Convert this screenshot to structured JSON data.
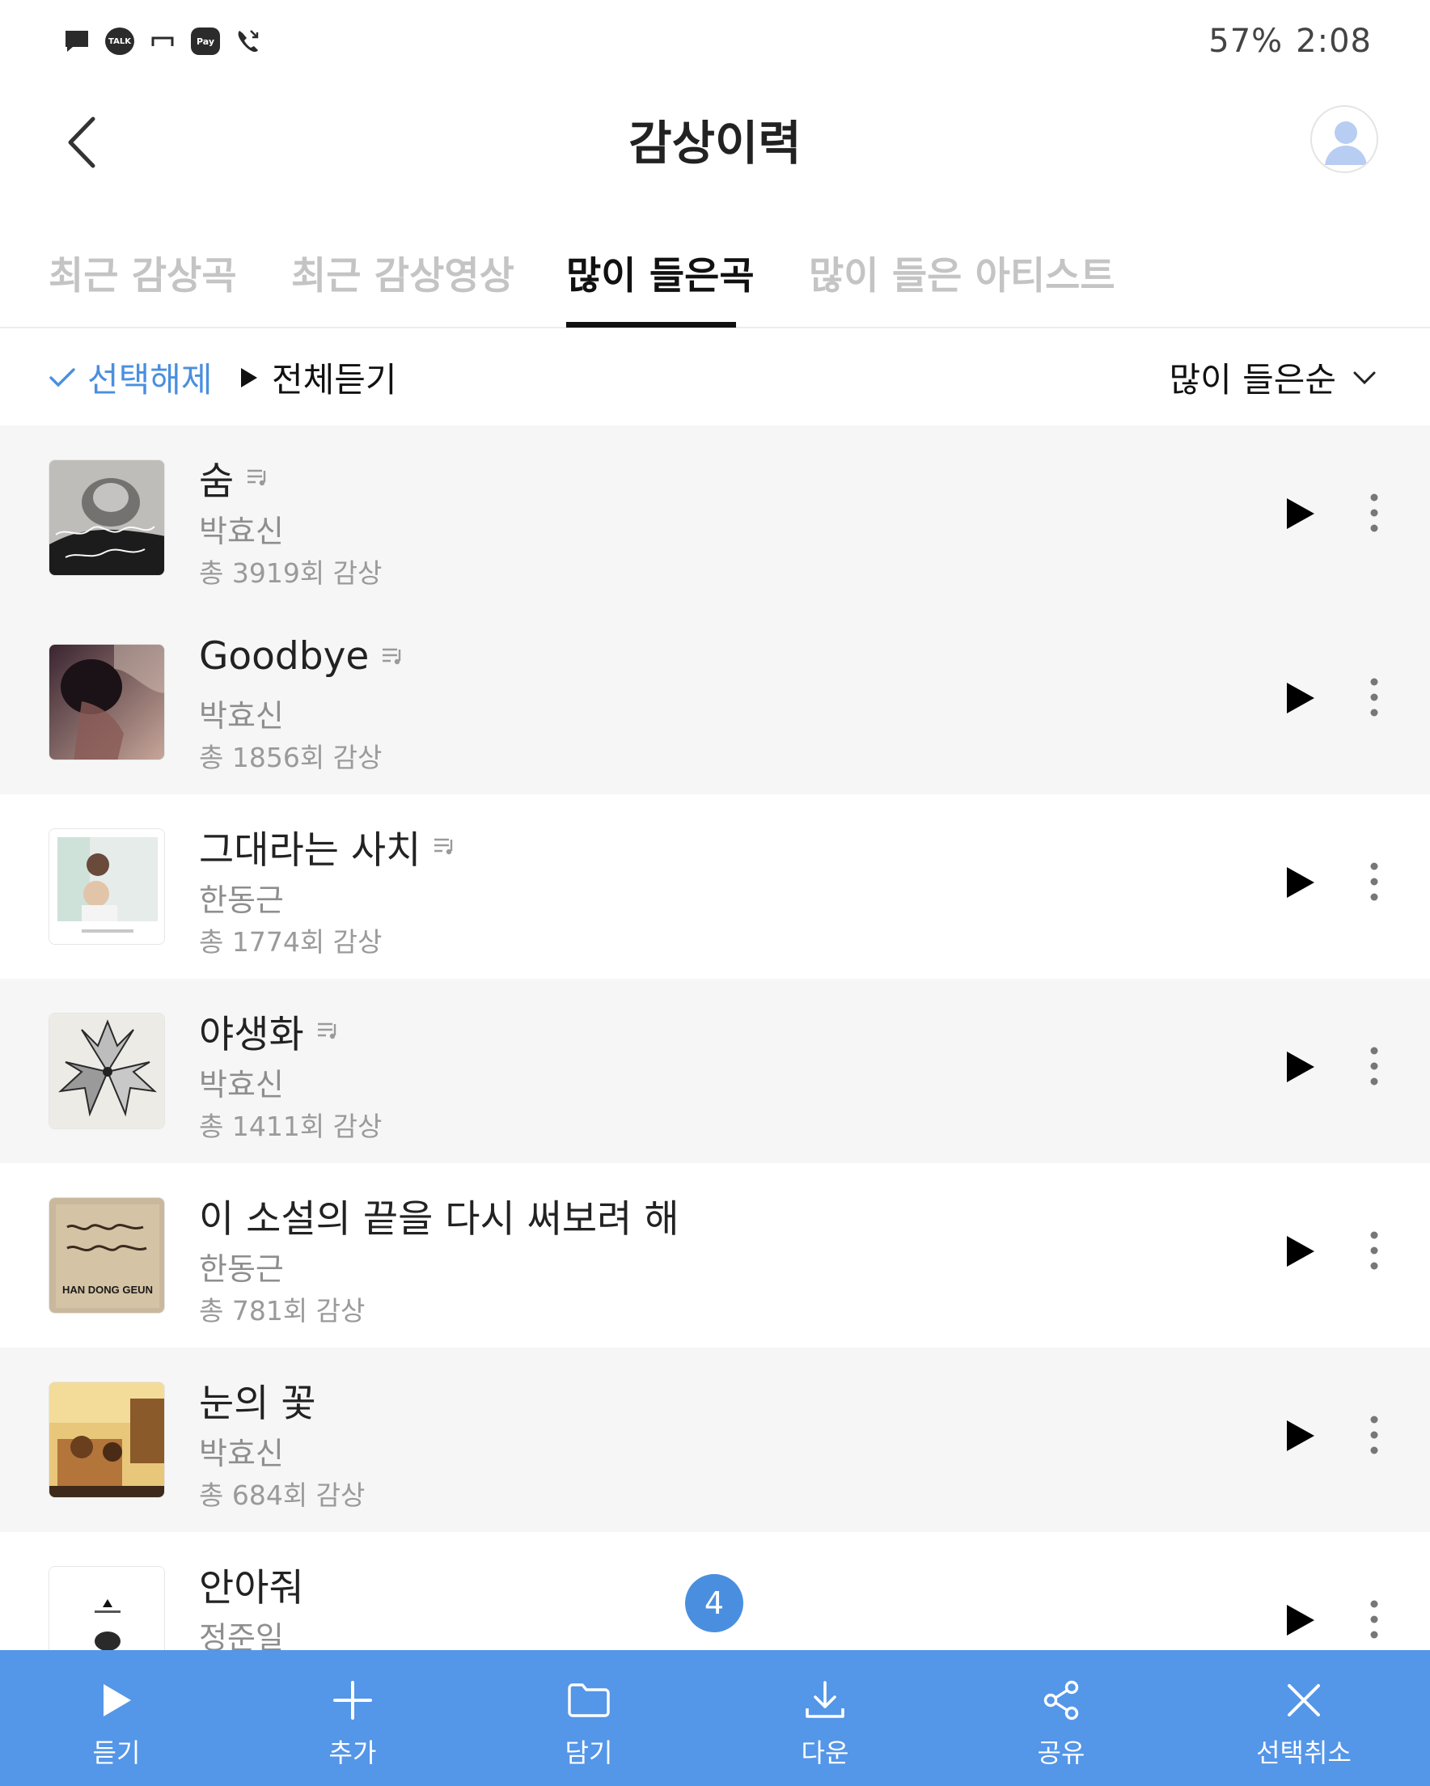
{
  "status_bar": {
    "talk_label": "TALK",
    "pay_label": "Pay",
    "battery": "57%",
    "time": "2:08"
  },
  "header": {
    "title": "감상이력"
  },
  "tabs": [
    {
      "label": "최근 감상곡",
      "active": false
    },
    {
      "label": "최근 감상영상",
      "active": false
    },
    {
      "label": "많이 들은곡",
      "active": true
    },
    {
      "label": "많이 들은 아티스트",
      "active": false
    }
  ],
  "toolbar": {
    "deselect_label": "선택해제",
    "play_all_label": "전체듣기",
    "sort_label": "많이 들은순"
  },
  "songs": [
    {
      "title": "숨",
      "artist": "박효신",
      "count": "총 3919회 감상",
      "selected": true,
      "has_lyrics": true
    },
    {
      "title": "Goodbye",
      "artist": "박효신",
      "count": "총 1856회 감상",
      "selected": true,
      "has_lyrics": true
    },
    {
      "title": "그대라는 사치",
      "artist": "한동근",
      "count": "총 1774회 감상",
      "selected": false,
      "has_lyrics": true
    },
    {
      "title": "야생화",
      "artist": "박효신",
      "count": "총 1411회 감상",
      "selected": true,
      "has_lyrics": true
    },
    {
      "title": "이 소설의 끝을 다시 써보려 해",
      "artist": "한동근",
      "count": "총 781회 감상",
      "selected": false,
      "has_lyrics": false,
      "album_text": "HAN DONG GEUN"
    },
    {
      "title": "눈의 꽃",
      "artist": "박효신",
      "count": "총 684회 감상",
      "selected": true,
      "has_lyrics": false
    },
    {
      "title": "안아줘",
      "artist": "정준일",
      "count": "",
      "selected": false,
      "has_lyrics": false
    }
  ],
  "selection_count": "4",
  "actions": [
    {
      "label": "듣기",
      "icon": "play-icon"
    },
    {
      "label": "추가",
      "icon": "plus-icon"
    },
    {
      "label": "담기",
      "icon": "folder-icon"
    },
    {
      "label": "다운",
      "icon": "download-icon"
    },
    {
      "label": "공유",
      "icon": "share-icon"
    },
    {
      "label": "선택취소",
      "icon": "close-icon"
    }
  ],
  "colors": {
    "accent": "#4a8fdf",
    "action_bar": "#5496e8",
    "selected_row": "#f6f6f6"
  }
}
